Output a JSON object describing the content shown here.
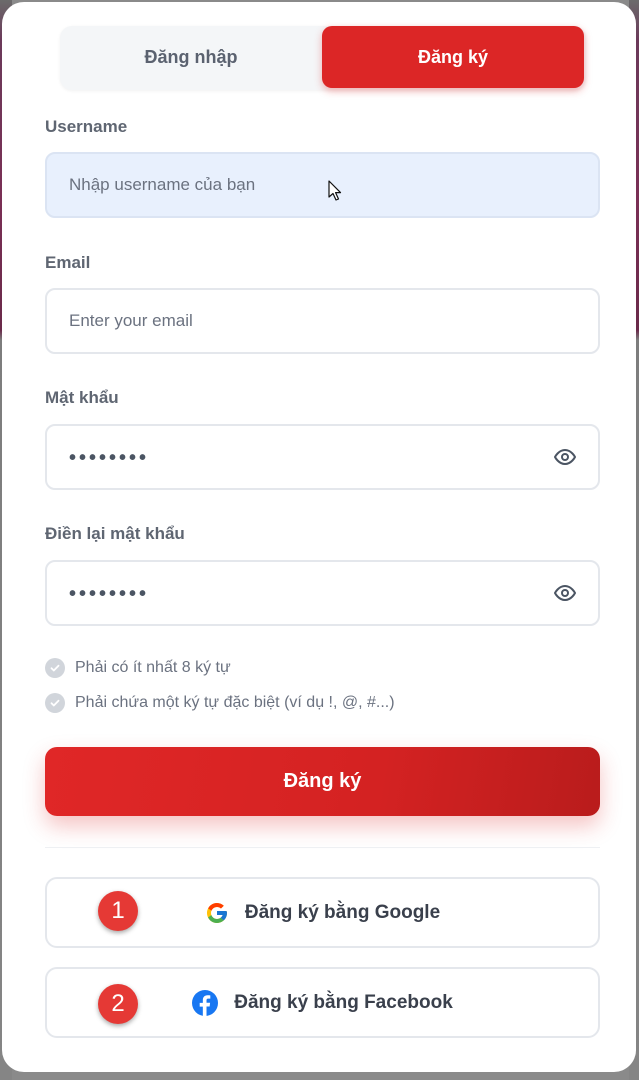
{
  "tabs": {
    "login": "Đăng nhập",
    "signup": "Đăng ký",
    "active": "signup"
  },
  "form": {
    "username": {
      "label": "Username",
      "placeholder": "Nhập username của bạn",
      "value": ""
    },
    "email": {
      "label": "Email",
      "placeholder": "Enter your email",
      "value": ""
    },
    "password": {
      "label": "Mật khẩu",
      "masked_value": "••••••••"
    },
    "confirm_password": {
      "label": "Điền lại mật khẩu",
      "masked_value": "••••••••"
    }
  },
  "rules": [
    {
      "text": "Phải có ít nhất 8 ký tự"
    },
    {
      "text": "Phải chứa một ký tự đặc biệt (ví dụ !, @, #...)"
    }
  ],
  "submit_label": "Đăng ký",
  "social": {
    "google_label": "Đăng ký bằng Google",
    "facebook_label": "Đăng ký bằng Facebook"
  },
  "annotations": [
    "1",
    "2"
  ],
  "icons": {
    "password_toggle": "eye-icon",
    "google": "google-icon",
    "facebook": "facebook-icon",
    "rule_check": "check-circle-icon"
  },
  "colors": {
    "accent": "#dc2626",
    "badge": "#e53935",
    "facebook": "#1877f2"
  }
}
